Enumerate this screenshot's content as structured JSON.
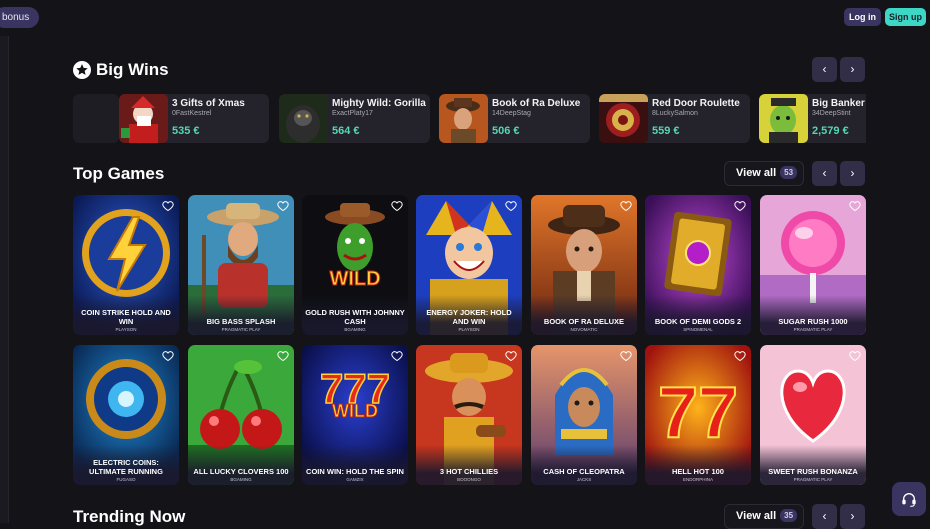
{
  "header": {
    "bonus_label": "bonus",
    "login_label": "Log in",
    "signup_label": "Sign up"
  },
  "big_wins": {
    "title": "Big Wins",
    "prev": "‹",
    "next": "›",
    "items": [
      {
        "game": "3 Gifts of Xmas",
        "user": "0FastKestrel",
        "amount": "535 €"
      },
      {
        "game": "Mighty Wild: Gorilla",
        "user": "ExactPlaty17",
        "amount": "564 €"
      },
      {
        "game": "Book of Ra Deluxe",
        "user": "14DeepStag",
        "amount": "506 €"
      },
      {
        "game": "Red Door Roulette",
        "user": "8LuckySalmon",
        "amount": "559 €"
      },
      {
        "game": "Big Banker B",
        "user": "34DeepStint",
        "amount": "2,579 €"
      }
    ]
  },
  "top_games": {
    "title": "Top Games",
    "view_all_label": "View all",
    "count": "53",
    "prev": "‹",
    "next": "›",
    "games": [
      {
        "name": "COIN STRIKE HOLD AND WIN",
        "provider": "PLAYSON",
        "art": "lightning-coin"
      },
      {
        "name": "BIG BASS SPLASH",
        "provider": "PRAGMATIC PLAY",
        "art": "fisherman"
      },
      {
        "name": "GOLD RUSH WITH JOHNNY CASH",
        "provider": "BGAMING",
        "art": "cactus-wild"
      },
      {
        "name": "ENERGY JOKER: HOLD AND WIN",
        "provider": "PLAYSON",
        "art": "joker"
      },
      {
        "name": "BOOK OF RA DELUXE",
        "provider": "NOVOMATIC",
        "art": "explorer"
      },
      {
        "name": "BOOK OF DEMI GODS 2",
        "provider": "SPINOMENAL",
        "art": "golden-book"
      },
      {
        "name": "SUGAR RUSH 1000",
        "provider": "PRAGMATIC PLAY",
        "art": "lollipop"
      },
      {
        "name": "ELECTRIC COINS: ULTIMATE RUNNING",
        "provider": "FUGASO",
        "art": "electric-coin"
      },
      {
        "name": "ALL LUCKY CLOVERS 100",
        "provider": "BGAMING",
        "art": "cherries"
      },
      {
        "name": "COIN WIN: HOLD THE SPIN",
        "provider": "GAMZIX",
        "art": "seven-wild"
      },
      {
        "name": "3 HOT CHILLIES",
        "provider": "BOOONGO",
        "art": "mariachi"
      },
      {
        "name": "CASH OF CLEOPATRA",
        "provider": "JACKS",
        "art": "cleopatra"
      },
      {
        "name": "HELL HOT 100",
        "provider": "ENDORPHINA",
        "art": "hot-seven"
      },
      {
        "name": "SWEET RUSH BONANZA",
        "provider": "PRAGMATIC PLAY",
        "art": "candy-heart"
      }
    ]
  },
  "trending": {
    "title": "Trending Now",
    "view_all_label": "View all",
    "count": "35",
    "prev": "‹",
    "next": "›"
  },
  "icons": {
    "star": "star-icon",
    "heart": "heart-outline-icon",
    "support": "headset-icon"
  },
  "colors": {
    "background": "#141318",
    "accent_purple": "#3a3460",
    "accent_teal": "#3ed7c5",
    "win_amount": "#55d6b4"
  }
}
